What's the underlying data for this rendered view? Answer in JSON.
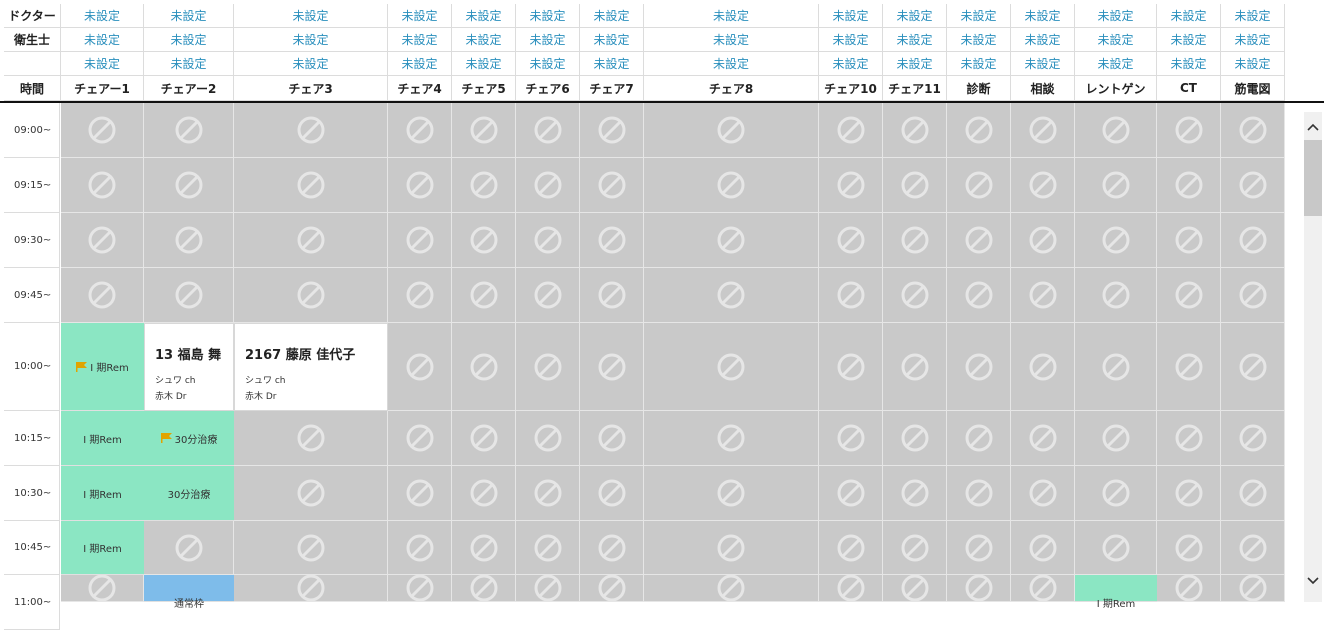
{
  "header": {
    "row_labels": [
      "ドクター",
      "衛生士",
      "",
      "時間"
    ],
    "unset_label": "未設定",
    "columns": [
      "チェアー1",
      "チェアー2",
      "チェア3",
      "チェア4",
      "チェア5",
      "チェア6",
      "チェア7",
      "チェア8",
      "チェア10",
      "チェア11",
      "診断",
      "相談",
      "レントゲン",
      "CT",
      "筋電図"
    ]
  },
  "times": [
    "09:00~",
    "09:15~",
    "09:30~",
    "09:45~",
    "10:00~",
    "10:15~",
    "10:30~",
    "10:45~",
    "11:00~"
  ],
  "appointments": {
    "c1_1000": "Ⅰ 期Rem",
    "c1_1015": "Ⅰ 期Rem",
    "c1_1030": "Ⅰ 期Rem",
    "c1_1045": "Ⅰ 期Rem",
    "c2_1015": "30分治療",
    "c2_1030": "30分治療",
    "c2_1100": "通常枠",
    "xray_1100": "Ⅰ 期Rem",
    "card1": {
      "title": "13 福島 舞",
      "line1": "シュワ ch",
      "line2": "赤木 Dr"
    },
    "card2": {
      "title": "2167 藤原 佳代子",
      "line1": "シュワ ch",
      "line2": "赤木 Dr"
    }
  },
  "scrollbar": {
    "up": "^",
    "down": "⌄"
  },
  "colors": {
    "link": "#2a8fbd",
    "blocked": "#c9c9c9",
    "green": "#8be6c3",
    "blue": "#7ebcea",
    "flag": "#e0a400"
  }
}
